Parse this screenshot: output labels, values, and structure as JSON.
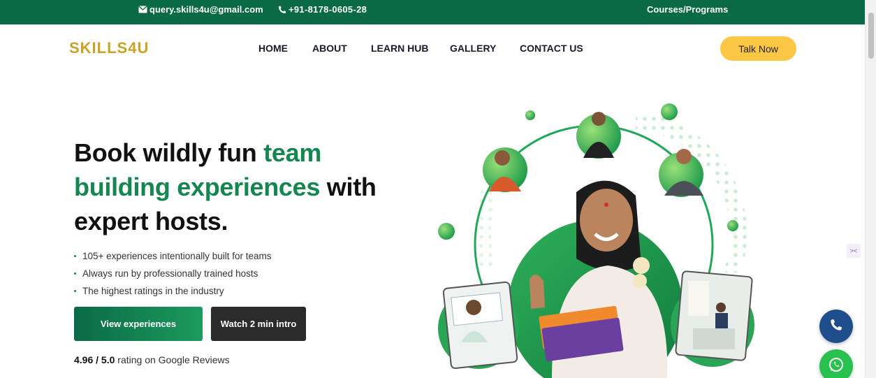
{
  "topbar": {
    "email": "query.skills4u@gmail.com",
    "phone": "+91-8178-0605-28",
    "courses": "Courses/Programs"
  },
  "header": {
    "logo": "SKILLS4U",
    "nav": [
      "HOME",
      "ABOUT",
      "LEARN HUB",
      "GALLERY",
      "CONTACT US"
    ],
    "cta": "Talk Now"
  },
  "hero": {
    "headline_1": "Book wildly fun ",
    "headline_2": "team building experiences",
    "headline_3": " with expert hosts.",
    "bullets": [
      "105+ experiences intentionally built for teams",
      "Always run by professionally trained hosts",
      "The highest ratings in the industry"
    ],
    "primary_button": "View experiences",
    "secondary_button": "Watch 2 min intro",
    "rating_value": "4.96 / 5.0",
    "rating_text": " rating on Google Reviews"
  },
  "colors": {
    "brand_green": "#0b6a46",
    "accent_green": "#14864f",
    "logo_gold": "#c9a227",
    "cta_yellow": "#fcc744"
  },
  "icons": [
    "envelope-icon",
    "phone-icon",
    "sparkle-icon",
    "phone-call-icon",
    "whatsapp-icon"
  ]
}
